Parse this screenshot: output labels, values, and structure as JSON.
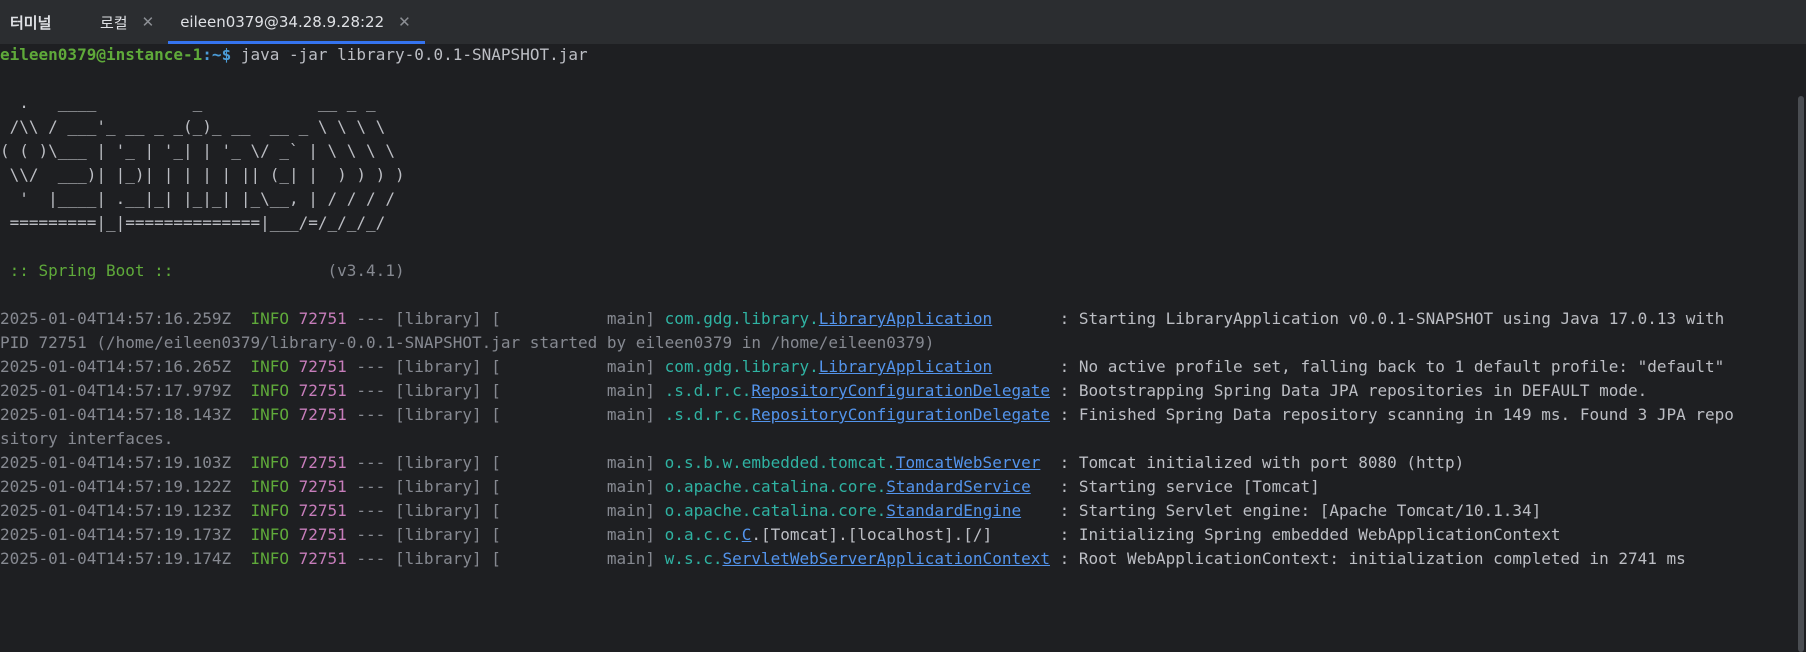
{
  "tabs": {
    "tool_title": "터미널",
    "local": "로컬",
    "ssh": "eileen0379@34.28.9.28:22",
    "close_glyph": "✕"
  },
  "prompt": {
    "user": "eileen0379@instance-1",
    "path": ":~$",
    "command": " java -jar library-0.0.1-SNAPSHOT.jar"
  },
  "banner": [
    "  .   ____          _            __ _ _",
    " /\\\\ / ___'_ __ _ _(_)_ __  __ _ \\ \\ \\ \\",
    "( ( )\\___ | '_ | '_| | '_ \\/ _` | \\ \\ \\ \\",
    " \\\\/  ___)| |_)| | | | | || (_| |  ) ) ) )",
    "  '  |____| .__|_| |_|_| |_\\__, | / / / /",
    " =========|_|==============|___/=/_/_/_/"
  ],
  "spring_boot": {
    "label": " :: Spring Boot ::",
    "version": "                (v3.4.1)"
  },
  "logs": [
    {
      "ts": "2025-01-04T14:57:16.259Z",
      "lvl": "  INFO",
      "pid": " 72751",
      "mid": " --- [library] [           main] ",
      "pkg": "com.gdg.library.",
      "cls": "LibraryApplication",
      "pad": "       ",
      "msg": ": Starting LibraryApplication v0.0.1-SNAPSHOT using Java 17.0.13 with"
    },
    {
      "ts": "",
      "lvl": "",
      "pid": "",
      "mid": "PID 72751 (/home/eileen0379/library-0.0.1-SNAPSHOT.jar started by eileen0379 in /home/eileen0379)",
      "pkg": "",
      "cls": "",
      "pad": "",
      "msg": ""
    },
    {
      "ts": "2025-01-04T14:57:16.265Z",
      "lvl": "  INFO",
      "pid": " 72751",
      "mid": " --- [library] [           main] ",
      "pkg": "com.gdg.library.",
      "cls": "LibraryApplication",
      "pad": "       ",
      "msg": ": No active profile set, falling back to 1 default profile: \"default\""
    },
    {
      "ts": "2025-01-04T14:57:17.979Z",
      "lvl": "  INFO",
      "pid": " 72751",
      "mid": " --- [library] [           main] ",
      "pkg": ".s.d.r.c.",
      "cls": "RepositoryConfigurationDelegate",
      "pad": " ",
      "msg": ": Bootstrapping Spring Data JPA repositories in DEFAULT mode."
    },
    {
      "ts": "2025-01-04T14:57:18.143Z",
      "lvl": "  INFO",
      "pid": " 72751",
      "mid": " --- [library] [           main] ",
      "pkg": ".s.d.r.c.",
      "cls": "RepositoryConfigurationDelegate",
      "pad": " ",
      "msg": ": Finished Spring Data repository scanning in 149 ms. Found 3 JPA repo"
    },
    {
      "ts": "",
      "lvl": "",
      "pid": "",
      "mid": "sitory interfaces.",
      "pkg": "",
      "cls": "",
      "pad": "",
      "msg": ""
    },
    {
      "ts": "2025-01-04T14:57:19.103Z",
      "lvl": "  INFO",
      "pid": " 72751",
      "mid": " --- [library] [           main] ",
      "pkg": "o.s.b.w.embedded.tomcat.",
      "cls": "TomcatWebServer",
      "pad": "  ",
      "msg": ": Tomcat initialized with port 8080 (http)"
    },
    {
      "ts": "2025-01-04T14:57:19.122Z",
      "lvl": "  INFO",
      "pid": " 72751",
      "mid": " --- [library] [           main] ",
      "pkg": "o.apache.catalina.core.",
      "cls": "StandardService",
      "pad": "   ",
      "msg": ": Starting service [Tomcat]"
    },
    {
      "ts": "2025-01-04T14:57:19.123Z",
      "lvl": "  INFO",
      "pid": " 72751",
      "mid": " --- [library] [           main] ",
      "pkg": "o.apache.catalina.core.",
      "cls": "StandardEngine",
      "pad": "    ",
      "msg": ": Starting Servlet engine: [Apache Tomcat/10.1.34]"
    },
    {
      "ts": "2025-01-04T14:57:19.173Z",
      "lvl": "  INFO",
      "pid": " 72751",
      "mid": " --- [library] [           main] ",
      "pkg": "o.a.c.c.",
      "cls": "C",
      "pad": "",
      "msg": ".[Tomcat].[localhost].[/]       : Initializing Spring embedded WebApplicationContext"
    },
    {
      "ts": "2025-01-04T14:57:19.174Z",
      "lvl": "  INFO",
      "pid": " 72751",
      "mid": " --- [library] [           main] ",
      "pkg": "w.s.c.",
      "cls": "ServletWebServerApplicationContext",
      "pad": " ",
      "msg": ": Root WebApplicationContext: initialization completed in 2741 ms"
    }
  ]
}
